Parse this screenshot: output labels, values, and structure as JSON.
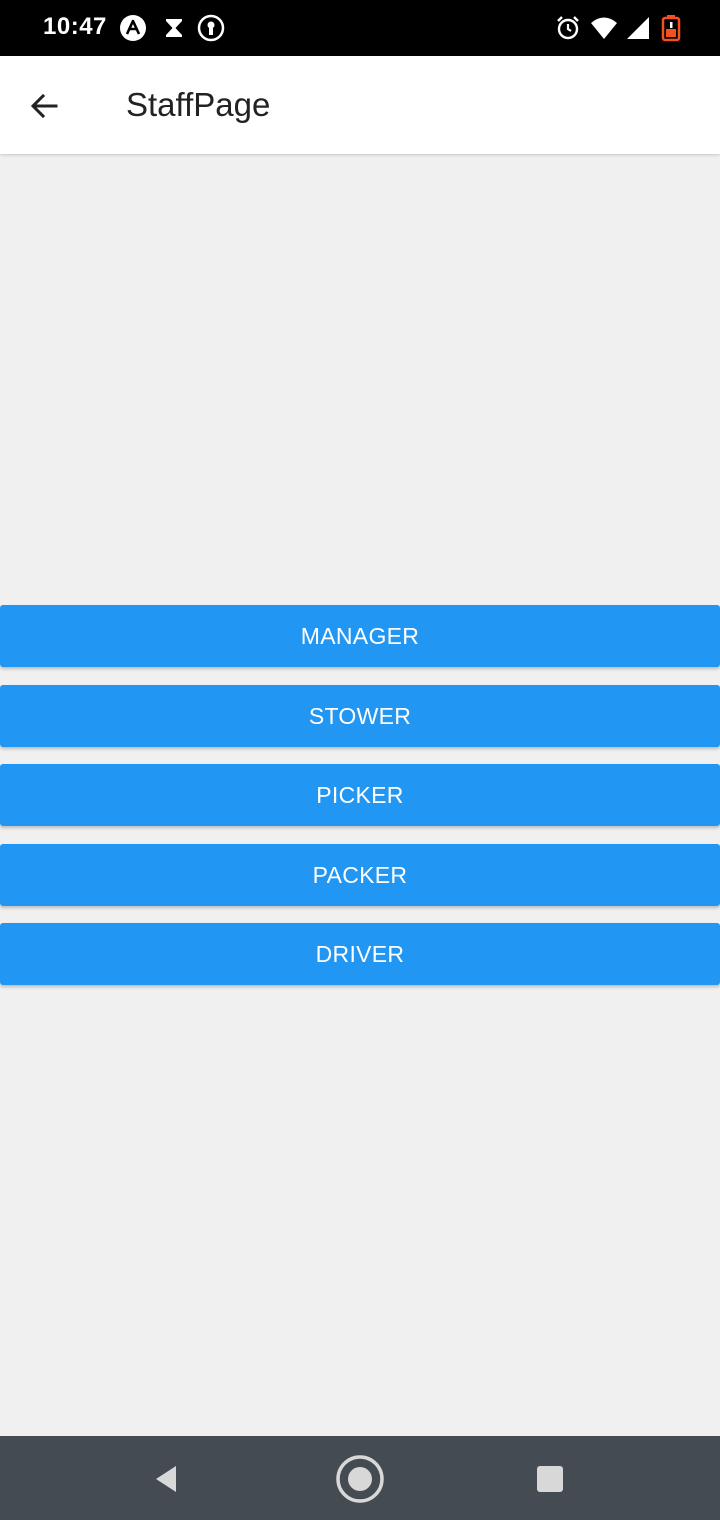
{
  "status_bar": {
    "time": "10:47",
    "icons": [
      "app-a-icon",
      "hourglass-icon",
      "keyhole-icon",
      "alarm-icon",
      "wifi-icon",
      "signal-icon",
      "battery-low-icon"
    ],
    "battery_color": "#f4511e"
  },
  "app_bar": {
    "title": "StaffPage",
    "back_icon": "arrow-back-icon"
  },
  "buttons": {
    "manager": "MANAGER",
    "stower": "STOWER",
    "picker": "PICKER",
    "packer": "PACKER",
    "driver": "DRIVER"
  },
  "colors": {
    "accent": "#2196f3",
    "background": "#f0f0f0",
    "nav_bar": "#454b52"
  },
  "nav_bar": {
    "icons": [
      "back-triangle-icon",
      "home-circle-icon",
      "recents-square-icon"
    ]
  }
}
